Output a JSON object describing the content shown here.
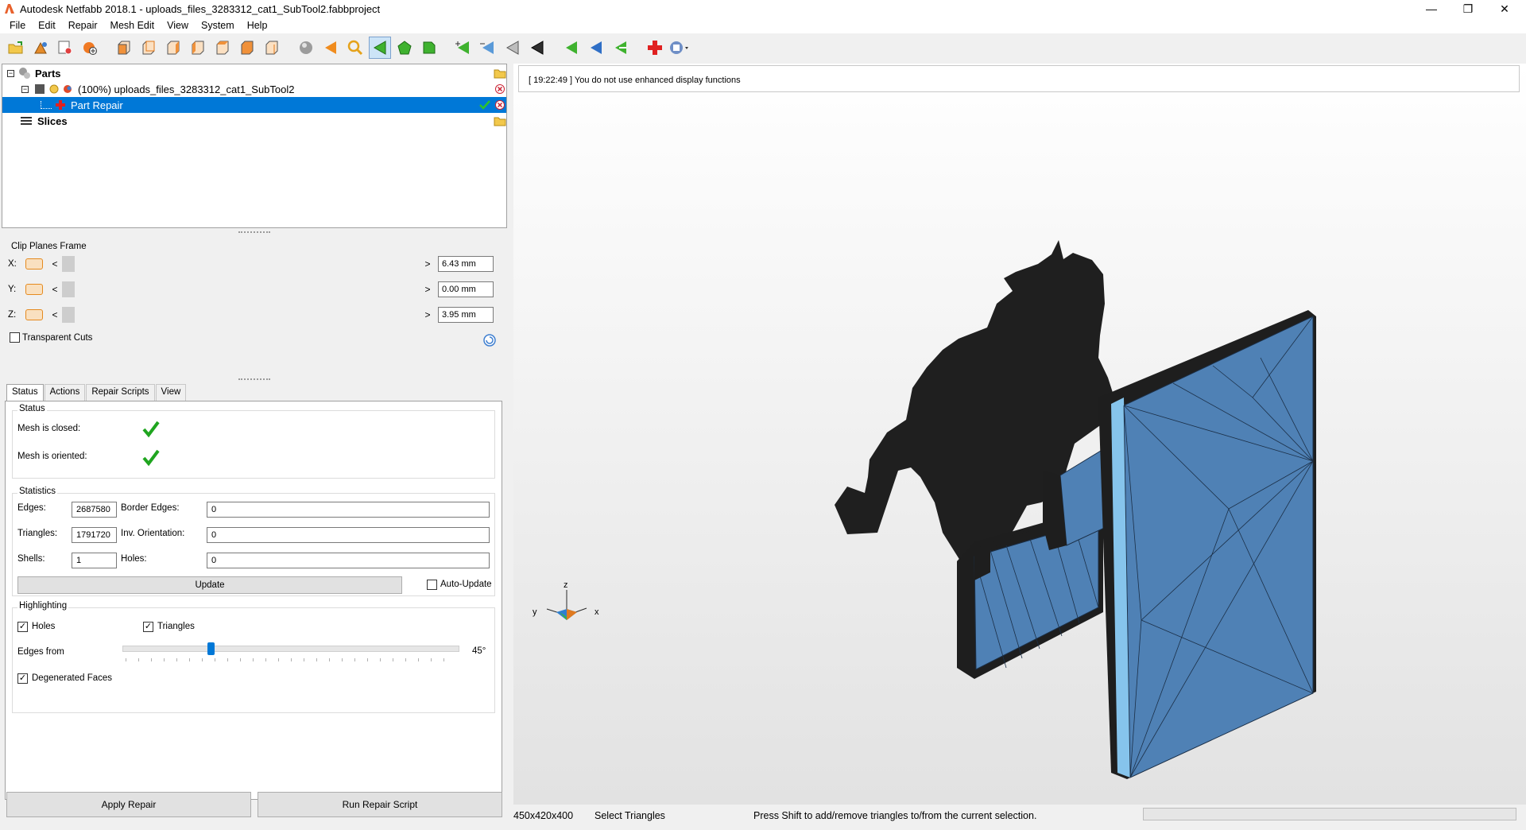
{
  "window": {
    "title": "Autodesk Netfabb 2018.1 - uploads_files_3283312_cat1_SubTool2.fabbproject",
    "minimize": "—",
    "maximize": "❐",
    "close": "✕"
  },
  "menu": [
    "File",
    "Edit",
    "Repair",
    "Mesh Edit",
    "View",
    "System",
    "Help"
  ],
  "tree": {
    "parts_label": "Parts",
    "part_label": "(100%) uploads_files_3283312_cat1_SubTool2",
    "repair_label": "Part Repair",
    "slices_label": "Slices"
  },
  "clip": {
    "title": "Clip Planes Frame",
    "rows": [
      {
        "axis": "X:",
        "value": "6.43 mm"
      },
      {
        "axis": "Y:",
        "value": "0.00 mm"
      },
      {
        "axis": "Z:",
        "value": "3.95 mm"
      }
    ],
    "transparent_label": "Transparent Cuts",
    "transparent_checked": false
  },
  "tabs": [
    "Status",
    "Actions",
    "Repair Scripts",
    "View"
  ],
  "status": {
    "title": "Status",
    "closed_label": "Mesh is closed:",
    "oriented_label": "Mesh is oriented:"
  },
  "statistics": {
    "title": "Statistics",
    "edges_label": "Edges:",
    "edges": "2687580",
    "border_edges_label": "Border Edges:",
    "border_edges": "0",
    "triangles_label": "Triangles:",
    "triangles": "1791720",
    "inv_orientation_label": "Inv. Orientation:",
    "inv_orientation": "0",
    "shells_label": "Shells:",
    "shells": "1",
    "holes_label": "Holes:",
    "holes": "0",
    "update_label": "Update",
    "auto_update_label": "Auto-Update"
  },
  "highlighting": {
    "title": "Highlighting",
    "holes_label": "Holes",
    "triangles_label": "Triangles",
    "edges_from_label": "Edges from",
    "edges_from_value": "45°",
    "edges_from_fraction": 0.26,
    "degenerated_label": "Degenerated Faces"
  },
  "buttons": {
    "apply_repair": "Apply Repair",
    "run_script": "Run Repair Script"
  },
  "viewport": {
    "log_message": "[ 19:22:49 ] You do not use enhanced display functions",
    "axis_z": "z",
    "axis_y": "y",
    "axis_x": "x"
  },
  "statusbar": {
    "dimensions": "450x420x400",
    "mode": "Select Triangles",
    "hint": "Press Shift to add/remove triangles to/from the current selection."
  },
  "colors": {
    "selection": "#0078d7",
    "mesh_blue": "#4f81b5",
    "silhouette": "#1f1f1f",
    "check_green": "#1fa51f"
  }
}
